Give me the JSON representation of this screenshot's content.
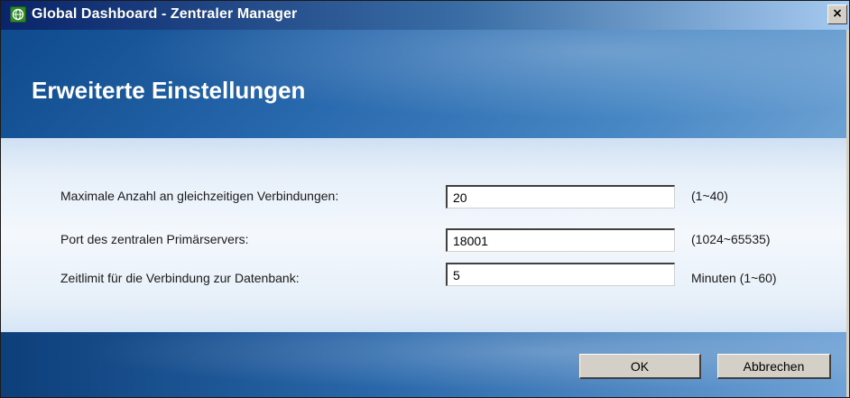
{
  "window": {
    "title": "Global Dashboard - Zentraler Manager",
    "close_label": "×"
  },
  "header": {
    "title": "Erweiterte Einstellungen"
  },
  "settings": [
    {
      "label": "Maximale Anzahl an gleichzeitigen Verbindungen:",
      "value": "20",
      "hint": "(1~40)"
    },
    {
      "label": "Port des zentralen Primärservers:",
      "value": "18001",
      "hint": "(1024~65535)"
    },
    {
      "label": "Zeitlimit für die Verbindung zur Datenbank:",
      "value": "5",
      "hint": "Minuten (1~60)"
    }
  ],
  "footer": {
    "ok_label": "OK",
    "cancel_label": "Abbrechen"
  },
  "icons": {
    "app": "app-globe-icon",
    "close": "close-icon"
  }
}
